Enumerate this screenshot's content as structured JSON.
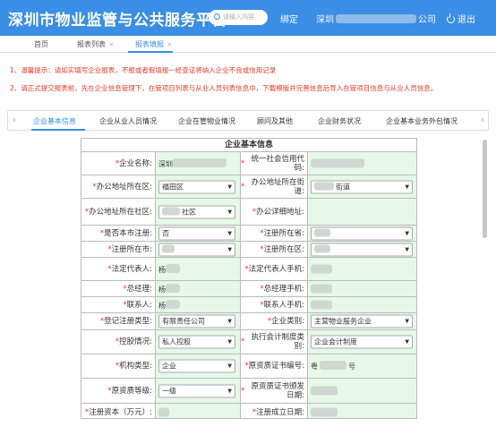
{
  "header": {
    "title": "深圳市物业监管与公共服务平台",
    "search_placeholder": "请输入内容",
    "bind_label": "绑定",
    "company_prefix": "深圳",
    "company_suffix": "公司",
    "logout_label": "退出",
    "bg_color": "#3a8ee6"
  },
  "tabs": [
    {
      "label": "首页",
      "closable": false
    },
    {
      "label": "报表列表",
      "closable": true
    },
    {
      "label": "报表填报",
      "closable": true,
      "active": true
    }
  ],
  "notices": [
    "1、温馨提示：请如实填写企业报表，不报或者假填报一经查证将纳入企业不良或信用记录",
    "2、请正式提交报表前，先在企业信息管理下，在管项目列表与从业人员列表信息中，下载模版并完善信息后导入在管项目信息与从业人员信息。"
  ],
  "subtabs": [
    "企业基本信息",
    "企业从业人员情况",
    "企业在管物业情况",
    "顾问及其他",
    "企业财务状况",
    "企业基本业务外包情况"
  ],
  "form": {
    "title": "企业基本信息",
    "rows": [
      {
        "l1": "企业名称:",
        "v1": "深圳",
        "l2": "统一社会信用代码:",
        "v2": ""
      },
      {
        "l1": "办公地址所在区:",
        "s1": "福田区",
        "l2": "办公地址所在街道:",
        "s2": "街道"
      },
      {
        "l1": "办公地址所在社区:",
        "s1": "社区",
        "l2": "办公详细地址:",
        "v2": ""
      },
      {
        "l1": "是否本市注册:",
        "s1": "否",
        "l2": "注册所在省:",
        "s2": ""
      },
      {
        "l1": "注册所在市:",
        "s1": "",
        "l2": "注册所在区:",
        "s2": ""
      },
      {
        "l1": "法定代表人:",
        "v1": "杨",
        "l2": "法定代表人手机:",
        "v2": ""
      },
      {
        "l1": "总经理:",
        "v1": "杨",
        "l2": "总经理手机:",
        "v2": ""
      },
      {
        "l1": "联系人:",
        "v1": "杨",
        "l2": "联系人手机:",
        "v2": ""
      },
      {
        "l1": "登记注册类型:",
        "s1": "有限责任公司",
        "l2": "企业类别:",
        "s2": "主营物业服务企业"
      },
      {
        "l1": "控股情况:",
        "s1": "私人控股",
        "l2": "执行会计制度类别:",
        "s2": "企业会计制度"
      },
      {
        "l1": "机构类型:",
        "s1": "企业",
        "l2": "原资质证书编号:",
        "v2": "粤",
        "v2b": "号"
      },
      {
        "l1": "原资质等级:",
        "s1": "一级",
        "l2": "原资质证书颁发日期:",
        "v2": ""
      },
      {
        "l1": "注册资本（万元）:",
        "v1": "",
        "l2": "注册成立日期:",
        "v2": ""
      }
    ]
  }
}
